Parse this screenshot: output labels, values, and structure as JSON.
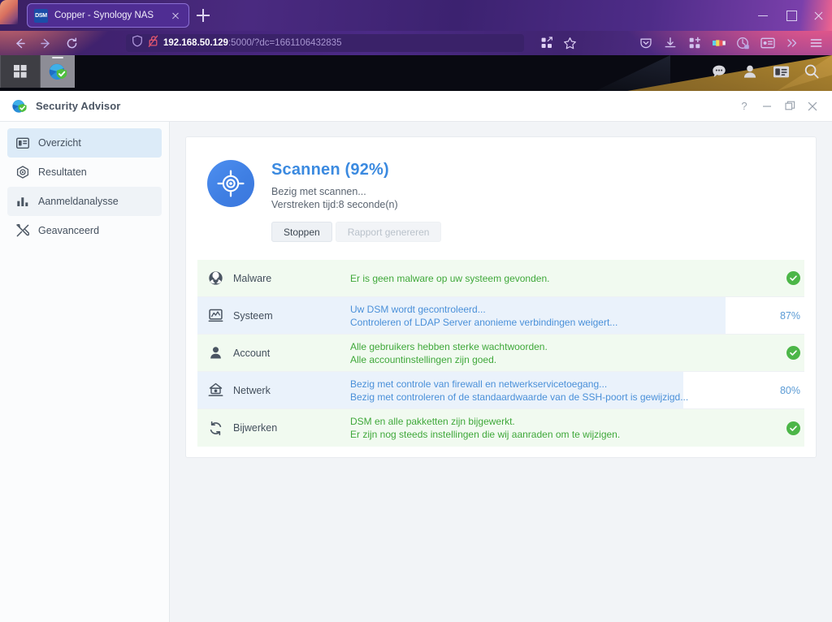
{
  "browser": {
    "tab": {
      "favicon_label": "DSM",
      "title": "Copper - Synology NAS",
      "close_icon": "close-icon"
    },
    "newtab_icon": "plus-icon",
    "window_controls": {
      "minimize": "minimize-icon",
      "maximize": "maximize-icon",
      "close": "close-icon"
    },
    "nav": {
      "back": "back-arrow-icon",
      "forward": "forward-arrow-icon",
      "reload": "reload-icon"
    },
    "url": {
      "shield_icon": "shield-icon",
      "lock_icon": "lock-broken-icon",
      "host": "192.168.50.129",
      "rest": ":5000/?dc=1661106432835"
    },
    "url_actions": [
      "extensions-icon",
      "bookmark-star-icon"
    ],
    "toolbar_icons": [
      "pocket-icon",
      "downloads-icon",
      "extensions-puzzle-icon",
      "color-palette-icon",
      "container-tab-icon",
      "account-card-icon",
      "overflow-chevrons-icon",
      "hamburger-menu-icon"
    ]
  },
  "dsm_taskbar": {
    "main_menu_icon": "grid-menu-icon",
    "running_app_icon": "security-advisor-icon",
    "tray_icons": [
      "notifications-icon",
      "user-icon",
      "widgets-icon",
      "search-icon"
    ]
  },
  "window": {
    "app_icon": "security-advisor-icon",
    "title": "Security Advisor",
    "controls": {
      "help": "?",
      "minimize": "minimize-icon",
      "maximize": "maximize-icon",
      "close": "close-icon"
    }
  },
  "sidebar": {
    "items": [
      {
        "label": "Overzicht",
        "icon": "overview-icon",
        "state": "selected"
      },
      {
        "label": "Resultaten",
        "icon": "results-target-icon",
        "state": "normal"
      },
      {
        "label": "Aanmeldanalysse",
        "icon": "bar-chart-icon",
        "state": "hover"
      },
      {
        "label": "Geavanceerd",
        "icon": "tools-icon",
        "state": "normal"
      }
    ]
  },
  "scan": {
    "badge_icon": "scan-target-icon",
    "title": "Scannen (92%)",
    "percent": 92,
    "status_line": "Bezig met scannen...",
    "elapsed_line": "Verstreken tijd:8 seconde(n)",
    "buttons": {
      "stop": "Stoppen",
      "report": "Rapport genereren"
    }
  },
  "results": {
    "rows": [
      {
        "name": "Malware",
        "icon": "biohazard-icon",
        "state": "ok",
        "messages": [
          "Er is geen malware op uw systeem gevonden."
        ],
        "status_icon": "check-circle-icon",
        "percent": null
      },
      {
        "name": "Systeem",
        "icon": "monitor-chart-icon",
        "state": "progress",
        "messages": [
          "Uw DSM wordt gecontroleerd...",
          "Controleren of LDAP Server anonieme verbindingen weigert..."
        ],
        "status_icon": null,
        "percent": 87,
        "percent_label": "87%"
      },
      {
        "name": "Account",
        "icon": "user-icon",
        "state": "ok",
        "messages": [
          "Alle gebruikers hebben sterke wachtwoorden.",
          "Alle accountinstellingen zijn goed."
        ],
        "status_icon": "check-circle-icon",
        "percent": null
      },
      {
        "name": "Netwerk",
        "icon": "router-icon",
        "state": "progress",
        "messages": [
          "Bezig met controle van firewall en netwerkservicetoegang...",
          "Bezig met controleren of de standaardwaarde van de SSH-poort is gewijzigd..."
        ],
        "status_icon": null,
        "percent": 80,
        "percent_label": "80%"
      },
      {
        "name": "Bijwerken",
        "icon": "refresh-icon",
        "state": "ok",
        "messages": [
          "DSM en alle pakketten zijn bijgewerkt.",
          "Er zijn nog steeds instellingen die wij aanraden om te wijzigen."
        ],
        "status_icon": "check-circle-icon",
        "percent": null
      }
    ]
  },
  "colors": {
    "accent_blue": "#3b8ae0",
    "ok_green": "#3fa83a",
    "check_green": "#4cb648",
    "progress_fill": "#eaf2fb",
    "ok_row_bg": "#f1faf0",
    "sidebar_selected": "#dcebf8",
    "browser_purple": "#4b2a86"
  }
}
